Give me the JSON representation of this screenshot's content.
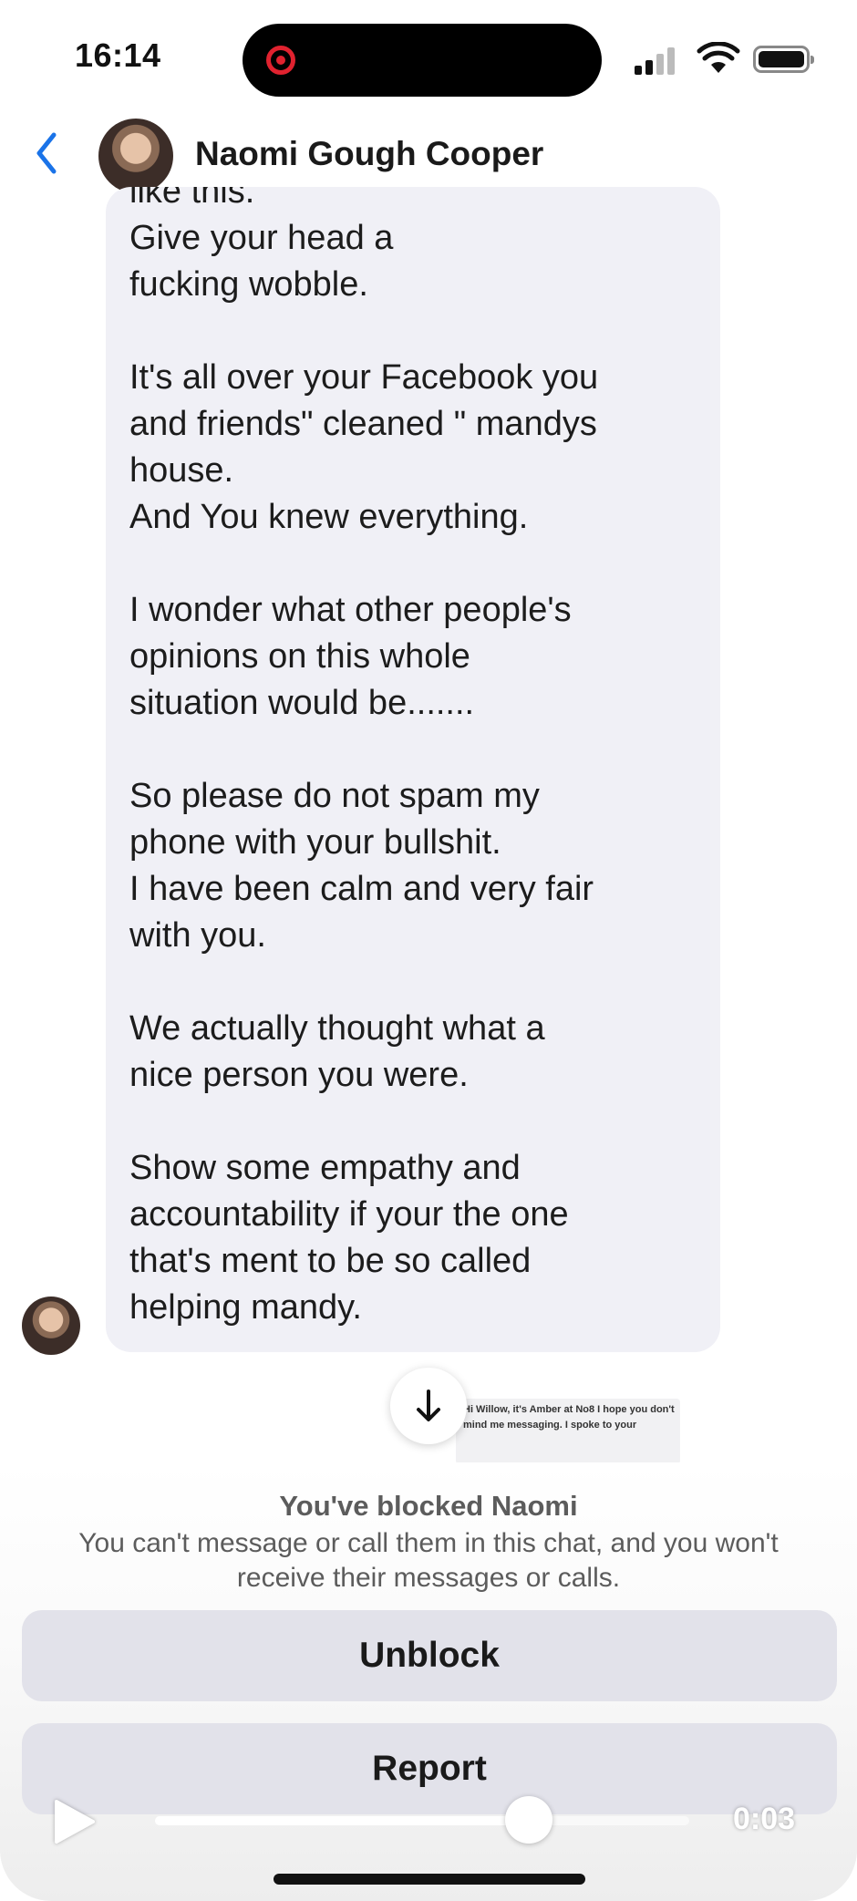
{
  "status_bar": {
    "time": "16:14",
    "icons": [
      "screen-record-icon",
      "cellular-signal-icon",
      "wifi-icon",
      "battery-icon"
    ]
  },
  "header": {
    "back_icon": "chevron-left-icon",
    "contact_name": "Naomi Gough Cooper"
  },
  "message": {
    "text": "like this.\nGive your head a\nfucking wobble.\n\nIt's all over your Facebook you\nand friends\" cleaned \" mandys\nhouse.\nAnd You knew everything.\n\nI wonder what other people's\nopinions on this whole\nsituation would be.......\n\nSo please do not spam my\nphone with your bullshit.\nI have been calm and very fair\nwith you.\n\nWe actually thought what a\nnice person you were.\n\nShow some empathy and\naccountability if your the one\nthat's ment to be so called\nhelping mandy."
  },
  "scroll_down_icon": "arrow-down-icon",
  "thumbnail_text": "Hi Willow, it's Amber at No8 I hope you don't mind me messaging. I spoke to your",
  "blocked": {
    "title": "You've blocked Naomi",
    "description": "You can't message or call them in this chat, and you won't receive their messages or calls.",
    "unblock_label": "Unblock",
    "report_label": "Report"
  },
  "video": {
    "play_icon": "play-icon",
    "time": "0:03",
    "progress": 0.7
  },
  "colors": {
    "accent_blue": "#1a73e8",
    "bubble_bg": "#f0f0f6",
    "button_bg": "#e2e2ea",
    "record_red": "#e0222f"
  }
}
